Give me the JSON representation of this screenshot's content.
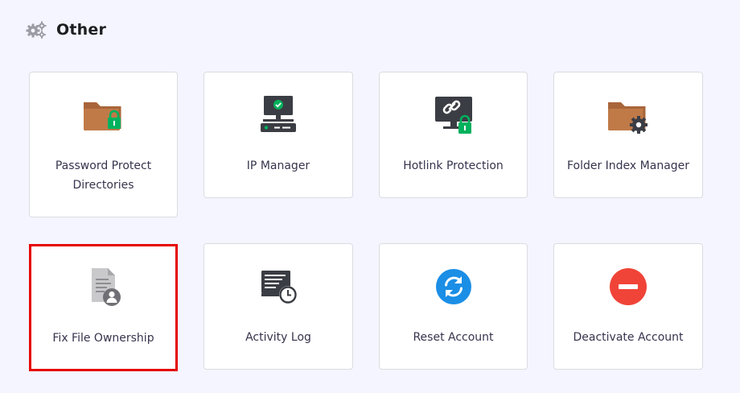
{
  "section": {
    "title": "Other",
    "icon": "gears-icon"
  },
  "cards": [
    {
      "label": "Password Protect Directories",
      "icon": "folder-lock-icon"
    },
    {
      "label": "IP Manager",
      "icon": "ip-monitor-icon"
    },
    {
      "label": "Hotlink Protection",
      "icon": "monitor-link-lock-icon"
    },
    {
      "label": "Folder Index Manager",
      "icon": "folder-gear-icon"
    },
    {
      "label": "Fix File Ownership",
      "icon": "file-user-icon",
      "selected": true
    },
    {
      "label": "Activity Log",
      "icon": "log-clock-icon"
    },
    {
      "label": "Reset Account",
      "icon": "refresh-icon"
    },
    {
      "label": "Deactivate Account",
      "icon": "no-entry-icon"
    }
  ],
  "colors": {
    "background": "#f4f5ff",
    "folder": "#c07a48",
    "lock": "#00b15d",
    "dark": "#3b3d44",
    "blue": "#1b8ee6",
    "red": "#f04438",
    "highlight": "#e60000"
  }
}
